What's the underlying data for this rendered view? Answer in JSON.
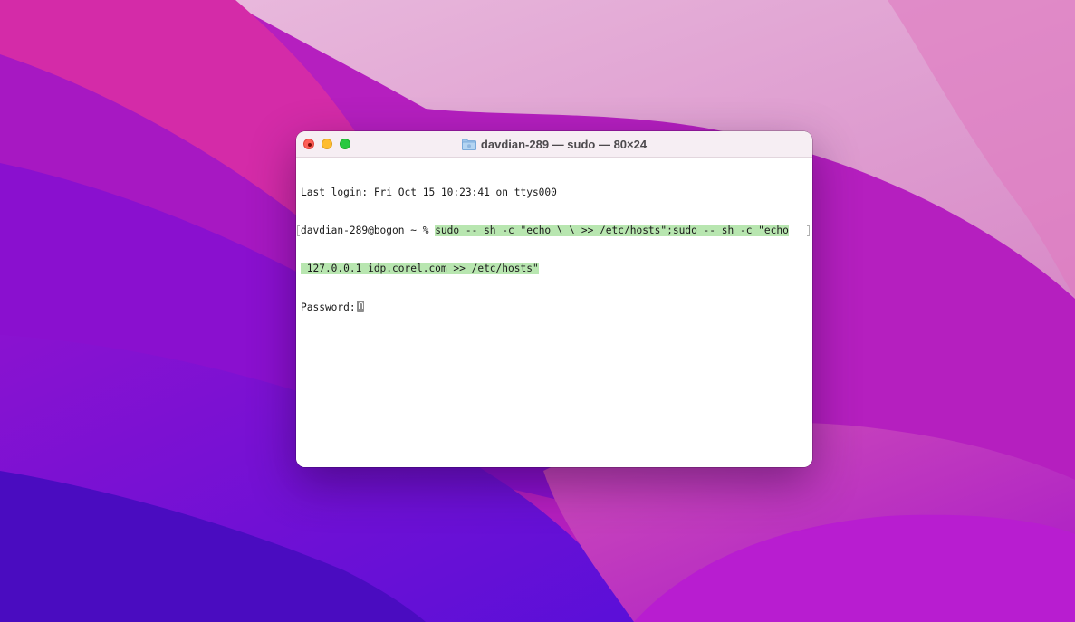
{
  "window": {
    "title": "davdian-289 — sudo — 80×24",
    "folder_icon": "folder-icon"
  },
  "terminal": {
    "last_login": "Last login: Fri Oct 15 10:23:41 on ttys000",
    "prompt": "davdian-289@bogon ~ % ",
    "command_line1": "sudo -- sh -c \"echo \\ \\ >> /etc/hosts\";sudo -- sh -c \"echo",
    "command_line2": " 127.0.0.1 idp.corel.com >> /etc/hosts\"",
    "password_prompt": "Password:",
    "highlight_color": "#b8e6b0"
  },
  "colors": {
    "close": "#fe5f57",
    "minimize": "#febc2e",
    "maximize": "#28c840"
  }
}
